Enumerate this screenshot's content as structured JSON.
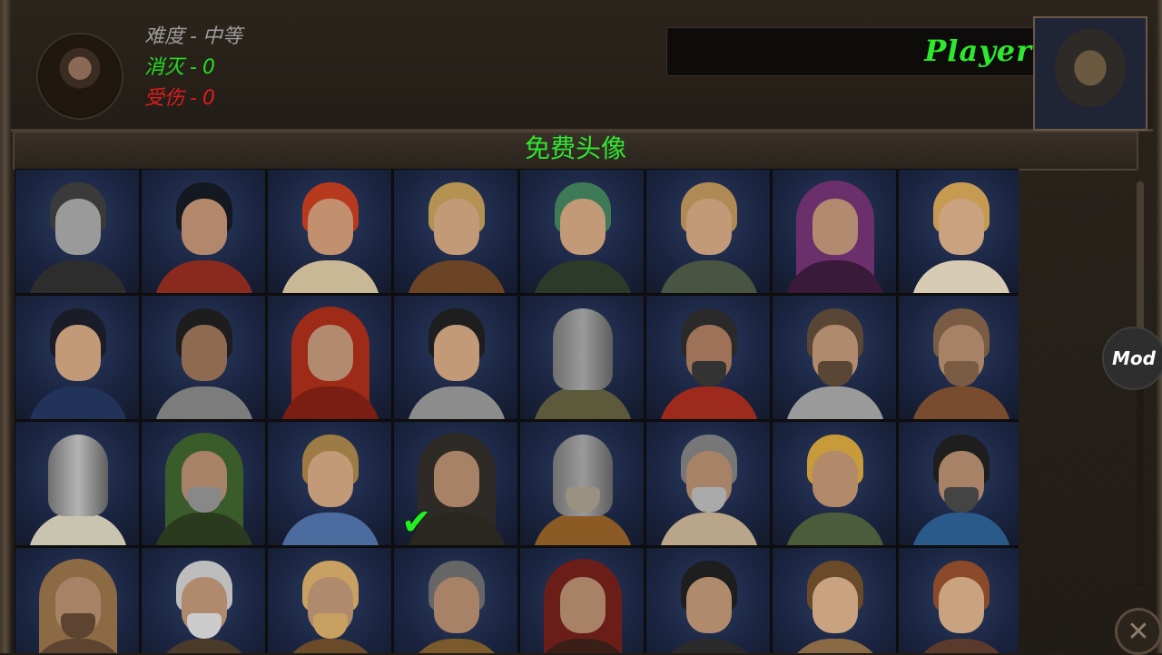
{
  "header": {
    "stats": [
      {
        "label": "难度",
        "value": "中等",
        "color": "#9c9c9c"
      },
      {
        "label": "消灭",
        "value": "0",
        "color": "#22dd22"
      },
      {
        "label": "受伤",
        "value": "0",
        "color": "#dd1d1d"
      }
    ],
    "stat_separator": "-",
    "player_name": "Player"
  },
  "section": {
    "title": "免费头像"
  },
  "portraits": [
    {
      "id": "p1",
      "kind": "face",
      "hair": "#3a3a3a",
      "skin": "#9a9a9a",
      "body": "#2d2d2d"
    },
    {
      "id": "p2",
      "kind": "face",
      "hair": "#141820",
      "skin": "#b3876c",
      "body": "#8a2a1e"
    },
    {
      "id": "p3",
      "kind": "face",
      "hair": "#b73a1f",
      "skin": "#c2906f",
      "body": "#c9b896"
    },
    {
      "id": "p4",
      "kind": "face",
      "hair": "#b39252",
      "skin": "#c29a78",
      "body": "#6b4426"
    },
    {
      "id": "p5",
      "kind": "face",
      "hair": "#3d7a55",
      "skin": "#c29a78",
      "body": "#2d3a2a"
    },
    {
      "id": "p6",
      "kind": "face",
      "hair": "#b08a55",
      "skin": "#c29a78",
      "body": "#4a5442"
    },
    {
      "id": "p7",
      "kind": "hood",
      "hair": "#6b2f6b",
      "skin": "#b28a70",
      "body": "#3a1a3a"
    },
    {
      "id": "p8",
      "kind": "face",
      "hair": "#c79a52",
      "skin": "#c9a280",
      "body": "#d8cbb4"
    },
    {
      "id": "p9",
      "kind": "face",
      "hair": "#1a1d28",
      "skin": "#c29a78",
      "body": "#22335a"
    },
    {
      "id": "p10",
      "kind": "face",
      "hair": "#1d1d1d",
      "skin": "#8e6a50",
      "body": "#7c7c7c"
    },
    {
      "id": "p11",
      "kind": "hood",
      "hair": "#9e2a18",
      "skin": "#b28a70",
      "body": "#7a1d12"
    },
    {
      "id": "p12",
      "kind": "face",
      "hair": "#1e1e1e",
      "skin": "#c29a78",
      "body": "#8c8c8c"
    },
    {
      "id": "p13",
      "kind": "helm",
      "hair": "#9a9a9a",
      "skin": "#9a9a9a",
      "body": "#5c5a3a"
    },
    {
      "id": "p14",
      "kind": "face",
      "hair": "#2a2a2a",
      "skin": "#9e7258",
      "body": "#9e2a1e",
      "beard": "#333"
    },
    {
      "id": "p15",
      "kind": "face",
      "hair": "#5a4634",
      "skin": "#b08a6c",
      "body": "#9a9a9a",
      "beard": "#5a4634"
    },
    {
      "id": "p16",
      "kind": "face",
      "hair": "#7a5c44",
      "skin": "#a88266",
      "body": "#7a4c2e",
      "beard": "#7a5c44"
    },
    {
      "id": "p17",
      "kind": "helm",
      "hair": "#b4b4b4",
      "skin": "#b4b4b4",
      "body": "#c9c4b0"
    },
    {
      "id": "p18",
      "kind": "hood",
      "hair": "#3a5c2a",
      "skin": "#a88266",
      "body": "#2a3a1e",
      "beard": "#888"
    },
    {
      "id": "p19",
      "kind": "face",
      "hair": "#9c7b44",
      "skin": "#c29a78",
      "body": "#4c6ca0"
    },
    {
      "id": "p20",
      "kind": "hood",
      "hair": "#2e2a26",
      "skin": "#a88266",
      "body": "#2a2620",
      "selected": true
    },
    {
      "id": "p21",
      "kind": "helm",
      "hair": "#9a9a9a",
      "skin": "#9a9a9a",
      "body": "#8c5a24",
      "beard": "#9a9080"
    },
    {
      "id": "p22",
      "kind": "face",
      "hair": "#777",
      "skin": "#a88266",
      "body": "#b9a58a",
      "beard": "#aaa"
    },
    {
      "id": "p23",
      "kind": "face",
      "hair": "#c79a3a",
      "skin": "#b28a6a",
      "body": "#4a5c3a"
    },
    {
      "id": "p24",
      "kind": "face",
      "hair": "#1e1e1e",
      "skin": "#a88266",
      "body": "#2a5a8a",
      "beard": "#444"
    },
    {
      "id": "p25",
      "kind": "hood",
      "hair": "#8c6a44",
      "skin": "#a88266",
      "body": "#5c4430",
      "beard": "#5c4430"
    },
    {
      "id": "p26",
      "kind": "face",
      "hair": "#bdbdbd",
      "skin": "#b08a6c",
      "body": "#4a3a2a",
      "beard": "#ccc"
    },
    {
      "id": "p27",
      "kind": "face",
      "hair": "#c7a062",
      "skin": "#b08a6c",
      "body": "#6b4a2a",
      "beard": "#c7a062"
    },
    {
      "id": "p28",
      "kind": "face",
      "hair": "#666",
      "skin": "#a88266",
      "body": "#7a5a2a"
    },
    {
      "id": "p29",
      "kind": "hood",
      "hair": "#6b1e18",
      "skin": "#a88266",
      "body": "#3a1e18"
    },
    {
      "id": "p30",
      "kind": "face",
      "hair": "#1e1e1e",
      "skin": "#b08a6c",
      "body": "#2a2a2a"
    },
    {
      "id": "p31",
      "kind": "face",
      "hair": "#6b4a2a",
      "skin": "#c9a280",
      "body": "#8a6a44"
    },
    {
      "id": "p32",
      "kind": "face",
      "hair": "#8a4a2a",
      "skin": "#c9a280",
      "body": "#5a3a2a"
    }
  ],
  "side": {
    "mod_label": "Mod",
    "close_glyph": "✕"
  },
  "colors": {
    "accent_green": "#2ee82e",
    "kill_green": "#22dd22",
    "damage_red": "#dd1d1d"
  }
}
